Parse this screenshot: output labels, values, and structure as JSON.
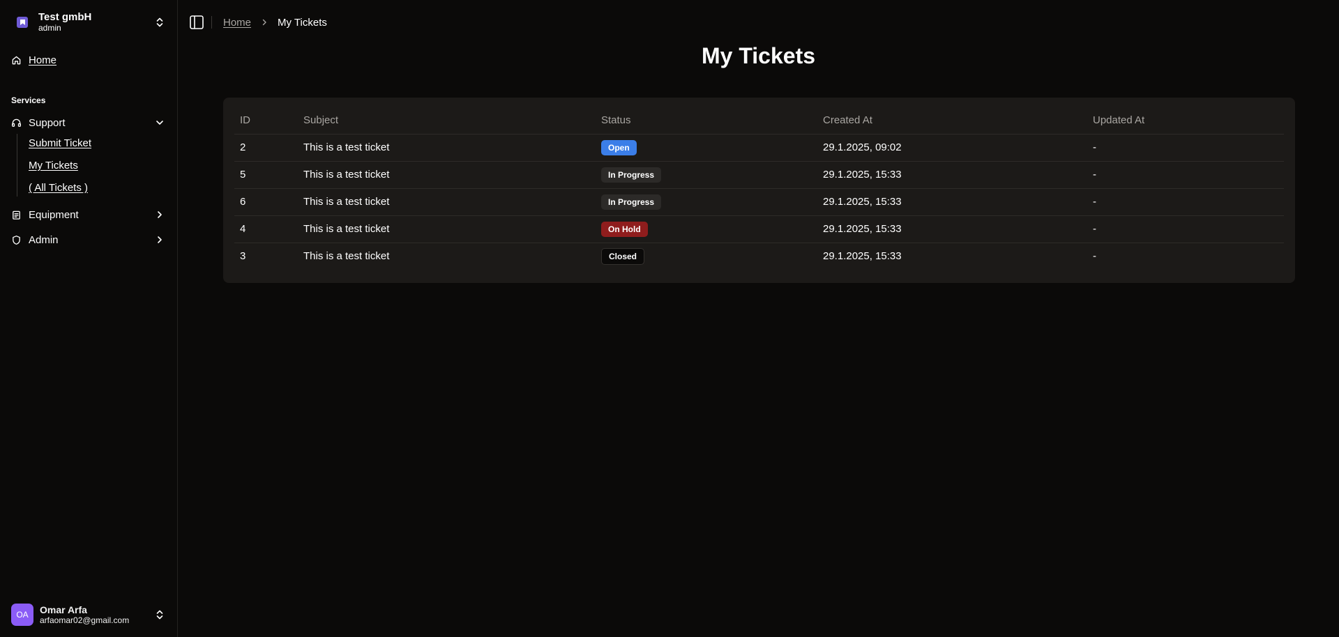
{
  "org": {
    "name": "Test gmbH",
    "role": "admin"
  },
  "sidebar": {
    "home_label": "Home",
    "section_title": "Services",
    "groups": [
      {
        "label": "Support",
        "icon": "headset-icon",
        "expanded": true
      },
      {
        "label": "Equipment",
        "icon": "clipboard-icon",
        "expanded": false
      },
      {
        "label": "Admin",
        "icon": "shield-icon",
        "expanded": false
      }
    ],
    "support_items": [
      "Submit Ticket",
      "My Tickets",
      "( All Tickets )"
    ]
  },
  "user": {
    "initials": "OA",
    "name": "Omar Arfa",
    "email": "arfaomar02@gmail.com"
  },
  "breadcrumb": {
    "home": "Home",
    "current": "My Tickets"
  },
  "page": {
    "title": "My Tickets"
  },
  "table": {
    "headers": [
      "ID",
      "Subject",
      "Status",
      "Created At",
      "Updated At"
    ],
    "rows": [
      {
        "id": "2",
        "subject": "This is a test ticket",
        "status": "Open",
        "created": "29.1.2025, 09:02",
        "updated": "-"
      },
      {
        "id": "5",
        "subject": "This is a test ticket",
        "status": "In Progress",
        "created": "29.1.2025, 15:33",
        "updated": "-"
      },
      {
        "id": "6",
        "subject": "This is a test ticket",
        "status": "In Progress",
        "created": "29.1.2025, 15:33",
        "updated": "-"
      },
      {
        "id": "4",
        "subject": "This is a test ticket",
        "status": "On Hold",
        "created": "29.1.2025, 15:33",
        "updated": "-"
      },
      {
        "id": "3",
        "subject": "This is a test ticket",
        "status": "Closed",
        "created": "29.1.2025, 15:33",
        "updated": "-"
      }
    ]
  },
  "status_colors": {
    "Open": {
      "bg": "#3b7ee8",
      "fg": "#ffffff"
    },
    "In Progress": {
      "bg": "#2c2a28",
      "fg": "#ffffff"
    },
    "On Hold": {
      "bg": "#8f1d1d",
      "fg": "#ffffff"
    },
    "Closed": {
      "bg": "#0b0a09",
      "fg": "#ffffff",
      "border": "#34312e"
    }
  }
}
